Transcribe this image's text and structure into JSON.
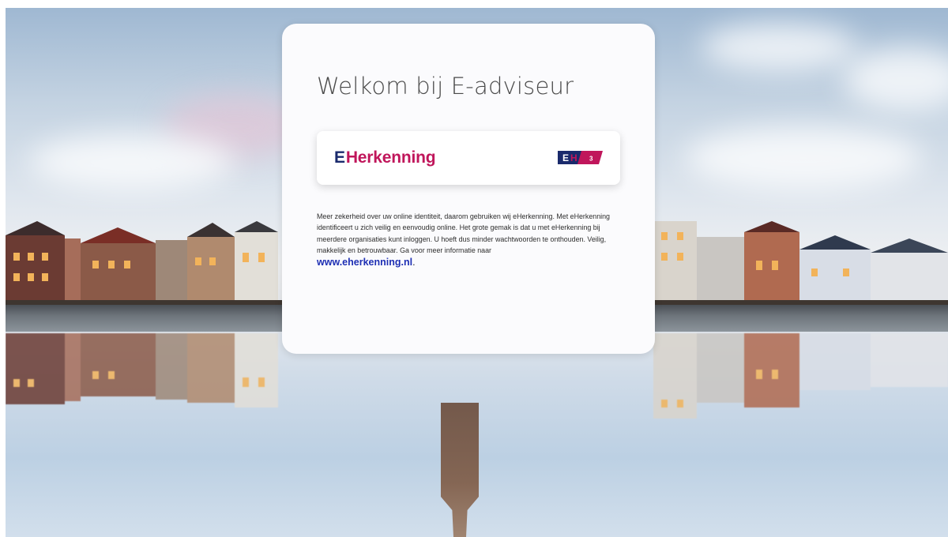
{
  "page": {
    "title": "Welkom bij E-adviseur"
  },
  "login_option": {
    "label_prefix": "E",
    "label_rest": "Herkenning",
    "badge_text": "3",
    "colors": {
      "primary": "#c0165b",
      "secondary": "#1a2a6c"
    }
  },
  "info": {
    "text": "Meer zekerheid over uw online identiteit, daarom gebruiken wij eHerkenning. Met eHerkenning identificeert u zich veilig en eenvoudig online. Het grote gemak is dat u met eHerkenning bij meerdere organisaties kunt inloggen. U hoeft dus minder wachtwoorden te onthouden. Veilig, makkelijk en betrouwbaar. Ga voor meer informatie naar",
    "link_text": "www.eherkenning.nl",
    "link_suffix": ".",
    "link_color": "#1e2fb4"
  }
}
